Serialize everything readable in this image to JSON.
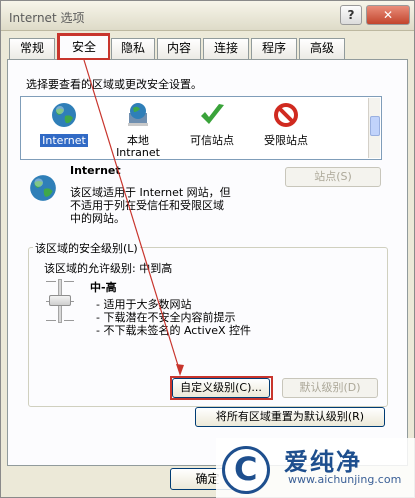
{
  "window": {
    "title": "Internet 选项",
    "help_glyph": "?",
    "close_glyph": "✕"
  },
  "tabs": [
    {
      "label": "常规"
    },
    {
      "label": "安全"
    },
    {
      "label": "隐私"
    },
    {
      "label": "内容"
    },
    {
      "label": "连接"
    },
    {
      "label": "程序"
    },
    {
      "label": "高级"
    }
  ],
  "active_tab": "安全",
  "security": {
    "zone_prompt": "选择要查看的区域或更改安全设置。",
    "zones": [
      {
        "label": "Internet",
        "icon": "globe-icon",
        "selected": true
      },
      {
        "label": "本地\nIntranet",
        "icon": "intranet-icon",
        "selected": false
      },
      {
        "label": "可信站点",
        "icon": "checkmark-icon",
        "selected": false
      },
      {
        "label": "受限站点",
        "icon": "restricted-icon",
        "selected": false
      }
    ],
    "zone_name": "Internet",
    "zone_desc_lines": [
      "该区域适用于 Internet 网站，但",
      "不适用于列在受信任和受限区域",
      "中的网站。"
    ],
    "sites_button": "站点(S)",
    "level_group_label": "该区域的安全级别(L)",
    "allowed_level": "该区域的允许级别: 中到高",
    "level_name": "中-高",
    "level_bullets": [
      "- 适用于大多数网站",
      "- 下载潜在不安全内容前提示",
      "- 不下载未签名的 ActiveX 控件"
    ],
    "custom_level_button": "自定义级别(C)...",
    "default_level_button": "默认级别(D)",
    "reset_all_button": "将所有区域重置为默认级别(R)"
  },
  "footer": {
    "ok_button": "确定"
  },
  "watermark": {
    "icon": "c-logo-icon",
    "text": "爱纯净",
    "url": "www.aichunjing.com",
    "color": "#1e4f8e"
  },
  "colors": {
    "highlight": "#c8352d",
    "selection": "#316ac5"
  }
}
